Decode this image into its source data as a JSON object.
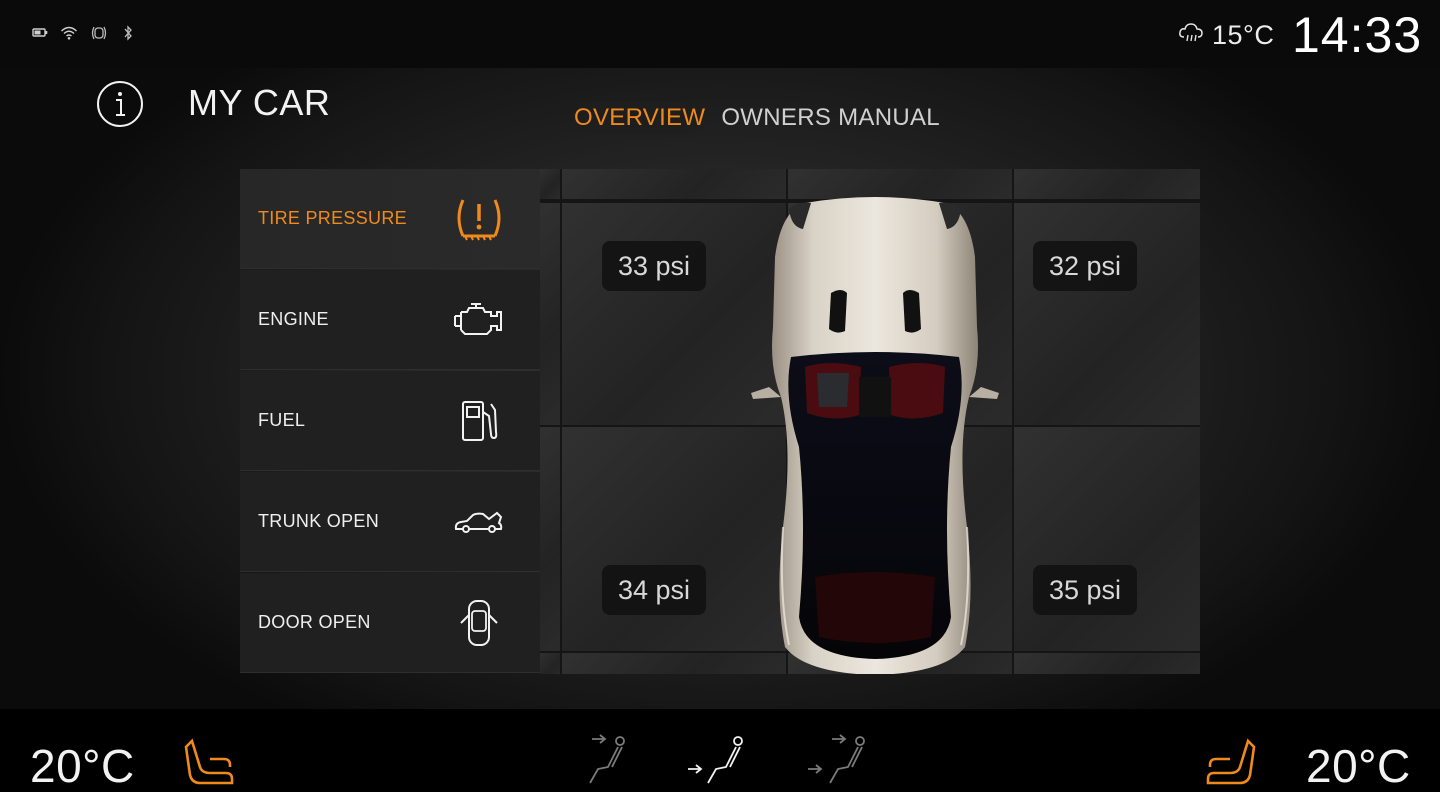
{
  "status_bar": {
    "icons": [
      "battery-icon",
      "wifi-icon",
      "tire-warning-icon",
      "bluetooth-icon"
    ],
    "weather_icon": "cloud-rain-icon",
    "weather_temp": "15°C",
    "clock": "14:33"
  },
  "header": {
    "info_icon": "info-icon",
    "title": "MY CAR"
  },
  "tabs": [
    {
      "label": "OVERVIEW",
      "active": true
    },
    {
      "label": "OWNERS MANUAL",
      "active": false
    }
  ],
  "sidebar": {
    "items": [
      {
        "label": "TIRE PRESSURE",
        "icon": "tire-pressure-icon",
        "active": true
      },
      {
        "label": "ENGINE",
        "icon": "engine-icon",
        "active": false
      },
      {
        "label": "FUEL",
        "icon": "fuel-pump-icon",
        "active": false
      },
      {
        "label": "TRUNK OPEN",
        "icon": "trunk-open-icon",
        "active": false
      },
      {
        "label": "DOOR OPEN",
        "icon": "door-open-icon",
        "active": false
      }
    ]
  },
  "tire_pressure": {
    "front_left": "33 psi",
    "front_right": "32 psi",
    "rear_left": "34 psi",
    "rear_right": "35 psi"
  },
  "climate": {
    "left_temp": "20°C",
    "right_temp": "20°C",
    "left_seat_icon": "seat-heat-icon",
    "right_seat_icon": "seat-heat-icon",
    "airflow_modes": [
      "airflow-face-icon",
      "airflow-feet-icon",
      "airflow-face-feet-icon"
    ]
  },
  "colors": {
    "accent": "#f08a1c",
    "text": "#efefef",
    "panel": "#202020"
  }
}
